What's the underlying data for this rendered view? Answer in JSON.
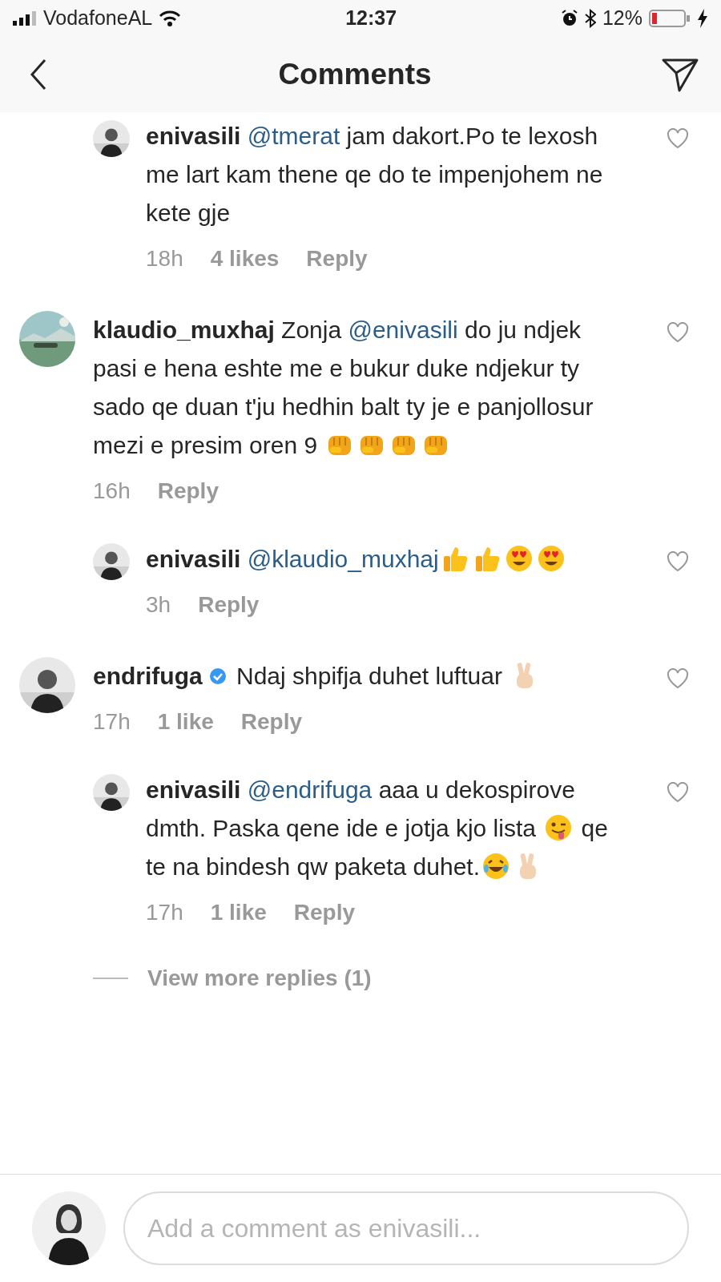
{
  "status_bar": {
    "carrier": "VodafoneAL",
    "time": "12:37",
    "battery": "12%"
  },
  "header": {
    "title": "Comments"
  },
  "earlier_replies": [
    {
      "user": "enivasili",
      "parts": [
        {
          "kind": "mention",
          "text": "@tmerat"
        },
        {
          "kind": "text",
          "text": " jam dakort.Po te lexosh me lart kam thene qe do te impenjohem ne kete gje"
        }
      ],
      "time": "18h",
      "likes": "4 likes",
      "reply": "Reply"
    }
  ],
  "comments": [
    {
      "user": "klaudio_muxhaj",
      "parts": [
        {
          "kind": "text",
          "text": "Zonja "
        },
        {
          "kind": "mention",
          "text": "@enivasili"
        },
        {
          "kind": "text",
          "text": " do ju ndjek pasi e hena eshte me e bukur duke ndjekur ty sado qe duan t'ju hedhin balt ty je e panjollosur mezi e presim oren 9 "
        },
        {
          "kind": "fist"
        },
        {
          "kind": "fist"
        },
        {
          "kind": "fist"
        },
        {
          "kind": "fist"
        }
      ],
      "time": "16h",
      "reply": "Reply",
      "children": [
        {
          "user": "enivasili",
          "parts": [
            {
              "kind": "mention",
              "text": "@klaudio_muxhaj"
            },
            {
              "kind": "thumbs-up"
            },
            {
              "kind": "thumbs-up"
            },
            {
              "kind": "heart-eyes"
            },
            {
              "kind": "heart-eyes"
            }
          ],
          "time": "3h",
          "reply": "Reply"
        }
      ]
    },
    {
      "user": "endrifuga",
      "verified": true,
      "parts": [
        {
          "kind": "text",
          "text": "Ndaj shpifja duhet luftuar "
        },
        {
          "kind": "victory"
        }
      ],
      "time": "17h",
      "likes": "1 like",
      "reply": "Reply",
      "children": [
        {
          "user": "enivasili",
          "parts": [
            {
              "kind": "mention",
              "text": "@endrifuga"
            },
            {
              "kind": "text",
              "text": " aaa u dekospirove dmth. Paska qene ide e jotja kjo lista "
            },
            {
              "kind": "wink-tongue"
            },
            {
              "kind": "text",
              "text": " qe te na bindesh qw paketa duhet."
            },
            {
              "kind": "laughing"
            },
            {
              "kind": "victory"
            }
          ],
          "time": "17h",
          "likes": "1 like",
          "reply": "Reply"
        }
      ],
      "view_more": "View more replies (1)"
    }
  ],
  "composer": {
    "placeholder": "Add a comment as enivasili..."
  }
}
